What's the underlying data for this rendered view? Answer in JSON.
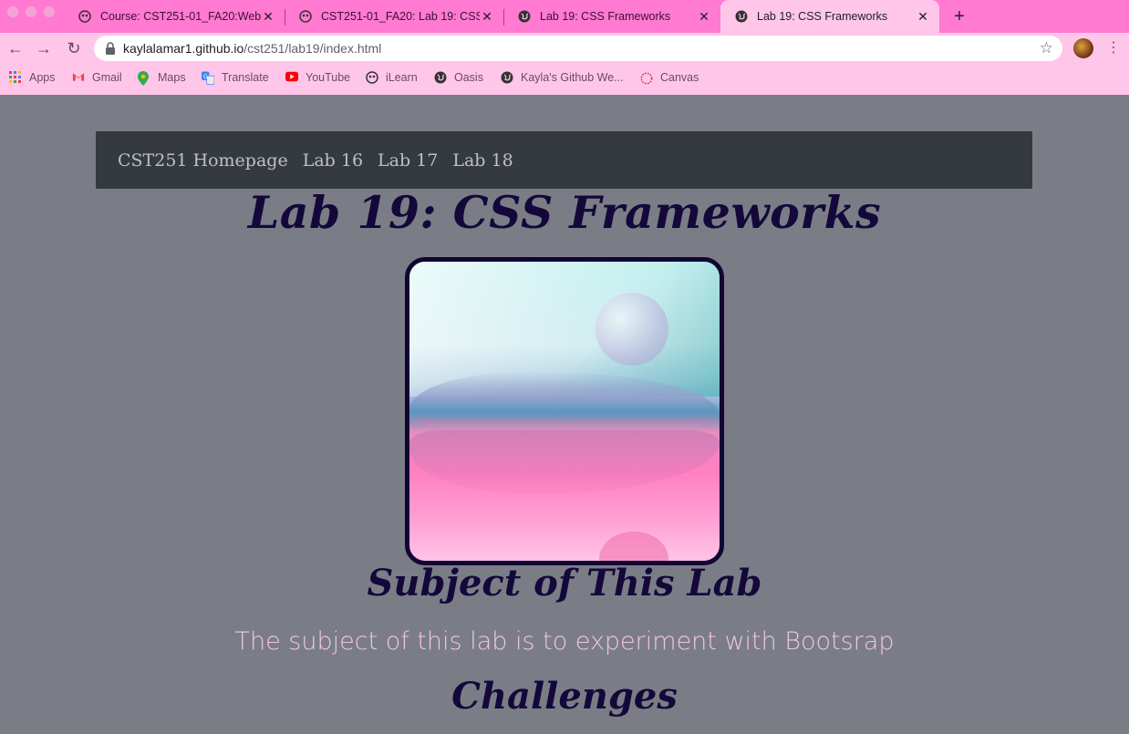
{
  "browser": {
    "tabs": [
      {
        "title": "Course: CST251-01_FA20:Web",
        "icon": "ilearn-icon",
        "active": false
      },
      {
        "title": "CST251-01_FA20: Lab 19: CSS",
        "icon": "ilearn-icon",
        "active": false
      },
      {
        "title": "Lab 19: CSS Frameworks",
        "icon": "globe-icon",
        "active": false
      },
      {
        "title": "Lab 19: CSS Frameworks",
        "icon": "globe-icon",
        "active": true
      }
    ],
    "close_glyph": "✕",
    "new_tab_glyph": "+",
    "url_host": "kaylalamar1.github.io",
    "url_path": "/cst251/lab19/index.html",
    "bookmarks": [
      {
        "label": "Apps",
        "icon": "apps-grid-icon"
      },
      {
        "label": "Gmail",
        "icon": "gmail-icon"
      },
      {
        "label": "Maps",
        "icon": "maps-icon"
      },
      {
        "label": "Translate",
        "icon": "translate-icon"
      },
      {
        "label": "YouTube",
        "icon": "youtube-icon"
      },
      {
        "label": "iLearn",
        "icon": "ilearn-icon"
      },
      {
        "label": "Oasis",
        "icon": "globe-icon"
      },
      {
        "label": "Kayla's Github We...",
        "icon": "globe-icon"
      },
      {
        "label": "Canvas",
        "icon": "canvas-icon"
      }
    ],
    "colors": {
      "tabstrip": "#ff7ad0",
      "toolbar": "#ffc6ea"
    }
  },
  "page": {
    "nav": [
      "CST251 Homepage",
      "Lab 16",
      "Lab 17",
      "Lab 18"
    ],
    "title": "Lab 19: CSS Frameworks",
    "subject_heading": "Subject of This Lab",
    "subject_text": "The subject of this lab is to experiment with Bootsrap",
    "challenges_heading": "Challenges",
    "colors": {
      "background": "#7b7d86",
      "navbar": "#343a40",
      "heading": "#14083a",
      "lead": "#f0c4e2"
    }
  }
}
